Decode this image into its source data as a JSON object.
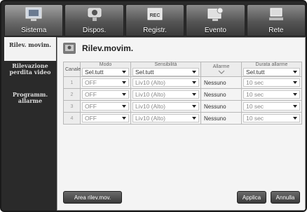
{
  "tabs": [
    {
      "label": "Sistema",
      "icon": "monitor-icon",
      "active": true
    },
    {
      "label": "Dispos.",
      "icon": "camera-icon",
      "active": false
    },
    {
      "label": "Registr.",
      "icon": "rec-icon",
      "active": false
    },
    {
      "label": "Evento",
      "icon": "alarm-monitor-icon",
      "active": false
    },
    {
      "label": "Rete",
      "icon": "network-icon",
      "active": false
    }
  ],
  "sidebar": {
    "items": [
      {
        "label": "Rilev. movim.",
        "active": true
      },
      {
        "label": "Rilevazione perdita video",
        "active": false
      },
      {
        "label": "Programm. allarme",
        "active": false
      }
    ]
  },
  "panel": {
    "title": "Rilev.movim.",
    "columns": {
      "canale": "Canale",
      "modo": "Modo",
      "sensibilita": "Sensibilità",
      "allarme": "Allarme",
      "durata": "Durata allarme"
    },
    "header_selects": {
      "modo": "Sel.tutt",
      "sensibilita": "Sel.tutt",
      "durata": "Sel.tutt"
    },
    "rows": [
      {
        "canale": "1",
        "modo": "OFF",
        "sensibilita": "Liv10 (Alto)",
        "allarme": "Nessuno",
        "durata": "10 sec"
      },
      {
        "canale": "2",
        "modo": "OFF",
        "sensibilita": "Liv10 (Alto)",
        "allarme": "Nessuno",
        "durata": "10 sec"
      },
      {
        "canale": "3",
        "modo": "OFF",
        "sensibilita": "Liv10 (Alto)",
        "allarme": "Nessuno",
        "durata": "10 sec"
      },
      {
        "canale": "4",
        "modo": "OFF",
        "sensibilita": "Liv10 (Alto)",
        "allarme": "Nessuno",
        "durata": "10 sec"
      }
    ]
  },
  "buttons": {
    "area": "Area rilev.mov.",
    "applica": "Applica",
    "annulla": "Annulla"
  }
}
